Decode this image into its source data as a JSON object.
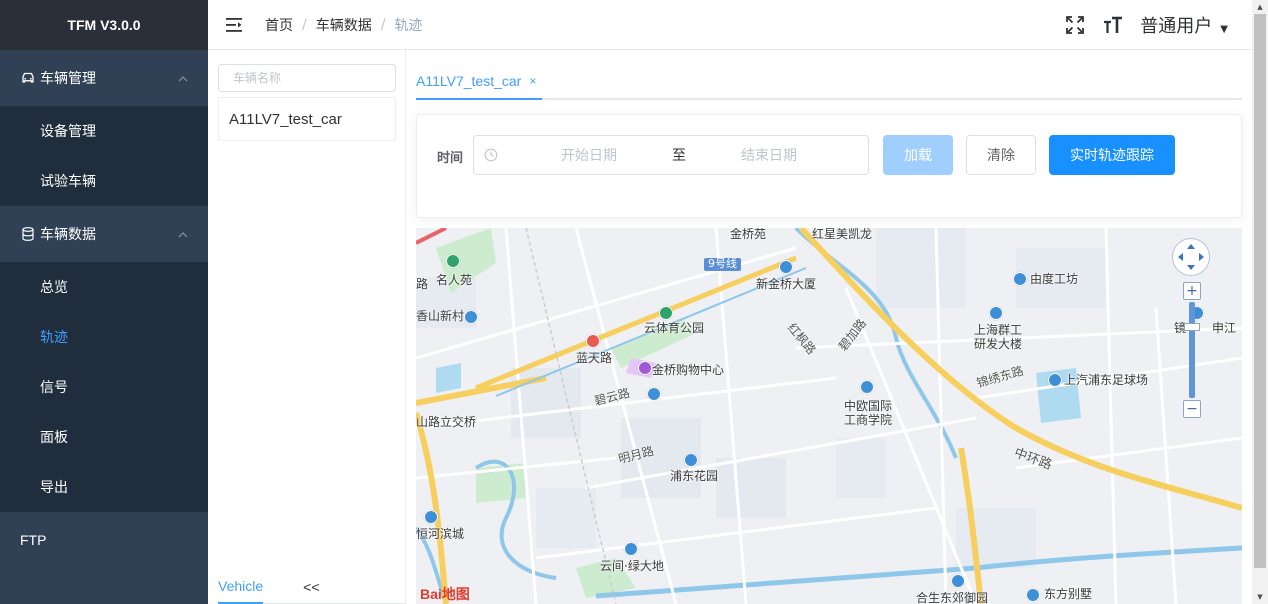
{
  "app": {
    "title": "TFM V3.0.0"
  },
  "sidebar": {
    "groups": [
      {
        "label": "车辆管理",
        "items": [
          {
            "label": "设备管理"
          },
          {
            "label": "试验车辆"
          }
        ]
      },
      {
        "label": "车辆数据",
        "items": [
          {
            "label": "总览"
          },
          {
            "label": "轨迹"
          },
          {
            "label": "信号"
          },
          {
            "label": "面板"
          },
          {
            "label": "导出"
          }
        ]
      }
    ],
    "ftp_label": "FTP",
    "active_item": "轨迹"
  },
  "header": {
    "breadcrumb": [
      "首页",
      "车辆数据",
      "轨迹"
    ],
    "separator": "/",
    "user_name": "普通用户"
  },
  "vehicle_panel": {
    "search_placeholder": "车辆名称",
    "vehicles": [
      "A11LV7_test_car"
    ],
    "tabs": [
      "Vehicle",
      "<<"
    ]
  },
  "main": {
    "tab_label": "A11LV7_test_car",
    "tab_close": "×",
    "filter": {
      "time_label": "时间",
      "start_placeholder": "开始日期",
      "range_separator": "至",
      "end_placeholder": "结束日期",
      "load_button": "加载",
      "clear_button": "清除",
      "live_button": "实时轨迹跟踪"
    }
  },
  "map": {
    "places": [
      "金桥苑",
      "红星美凯龙",
      "名人苑",
      "9号线",
      "新金桥大厦",
      "由度工坊",
      "香山新村",
      "云体育公园",
      "上海群工",
      "研发大楼",
      "镜",
      "申江",
      "蓝天路",
      "金桥购物中心",
      "红枫路",
      "碧云路",
      "锦绣东路",
      "上汽浦东足球场",
      "山路立交桥",
      "中欧国际",
      "工商学院",
      "明月路",
      "浦东花园",
      "中环路",
      "恒河滨城",
      "云间·绿大地",
      "合生东郊御园",
      "东方别墅",
      "路",
      "碧加路"
    ],
    "logo_text": "Bai地图",
    "zoom_in": "+",
    "zoom_out": "−"
  },
  "colors": {
    "sidebar_bg": "#304156",
    "submenu_bg": "#1f2d3d",
    "accent": "#409eff",
    "live_button": "#1890ff",
    "load_button_disabled": "#a0cfff"
  }
}
